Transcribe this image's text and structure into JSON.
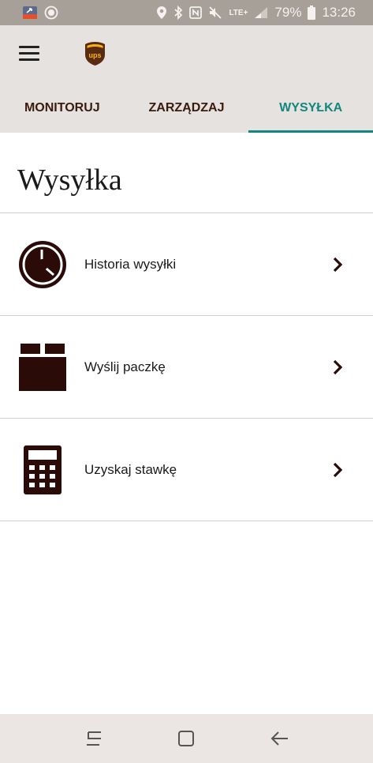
{
  "status_bar": {
    "left_icons": [
      "news-notification-icon",
      "circle-notification-icon"
    ],
    "right_icons": [
      "location-icon",
      "bluetooth-icon",
      "nfc-icon",
      "mute-icon",
      "signal-icon",
      "battery-icon"
    ],
    "network": "LTE+",
    "battery": "79%",
    "time": "13:26"
  },
  "app_bar": {
    "menu_icon": "hamburger-menu-icon",
    "logo_text": "ups",
    "colors": {
      "background": "#e5e2df",
      "tab_text": "#3a1b0e",
      "tab_active": "#13877e"
    }
  },
  "tabs": [
    {
      "label": "MONITORUJ",
      "active": false
    },
    {
      "label": "ZARZĄDZAJ",
      "active": false
    },
    {
      "label": "WYSYŁKA",
      "active": true
    }
  ],
  "page_title": "Wysyłka",
  "list": [
    {
      "icon": "clock-icon",
      "label": "Historia wysyłki"
    },
    {
      "icon": "package-icon",
      "label": "Wyślij paczkę"
    },
    {
      "icon": "calculator-icon",
      "label": "Uzyskaj stawkę"
    }
  ],
  "nav_bar": {
    "buttons": [
      "recent-apps-icon",
      "home-icon",
      "back-icon"
    ]
  },
  "icon_color": "#2a0b08"
}
